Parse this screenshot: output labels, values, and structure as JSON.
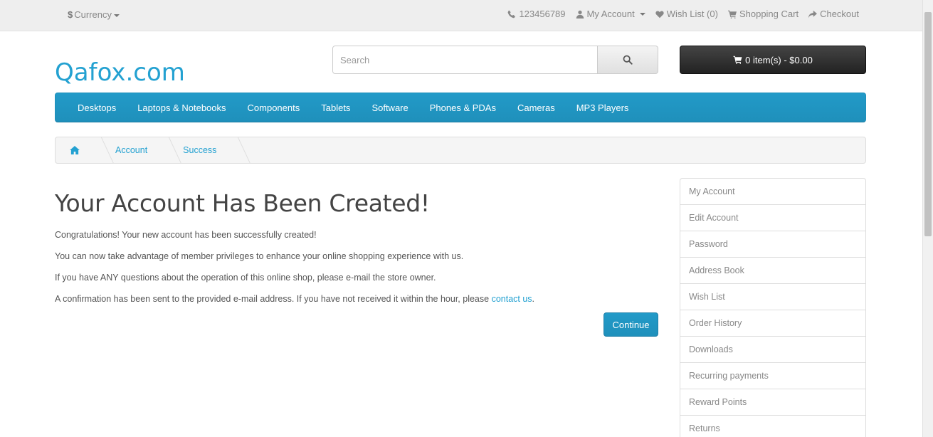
{
  "topbar": {
    "currency_symbol": "$",
    "currency_label": "Currency",
    "phone": "123456789",
    "my_account": "My Account",
    "wish_list": "Wish List (0)",
    "shopping_cart": "Shopping Cart",
    "checkout": "Checkout"
  },
  "header": {
    "logo": "Qafox.com",
    "search_placeholder": "Search",
    "cart_label": "0 item(s) - $0.00"
  },
  "menu": {
    "items": [
      "Desktops",
      "Laptops & Notebooks",
      "Components",
      "Tablets",
      "Software",
      "Phones & PDAs",
      "Cameras",
      "MP3 Players"
    ]
  },
  "breadcrumb": {
    "items": [
      "Account",
      "Success"
    ]
  },
  "main": {
    "title": "Your Account Has Been Created!",
    "p1": "Congratulations! Your new account has been successfully created!",
    "p2": "You can now take advantage of member privileges to enhance your online shopping experience with us.",
    "p3": "If you have ANY questions about the operation of this online shop, please e-mail the store owner.",
    "p4_text": "A confirmation has been sent to the provided e-mail address. If you have not received it within the hour, please ",
    "p4_link": "contact us",
    "p4_end": ".",
    "continue_label": "Continue"
  },
  "sidebar": {
    "items": [
      "My Account",
      "Edit Account",
      "Password",
      "Address Book",
      "Wish List",
      "Order History",
      "Downloads",
      "Recurring payments",
      "Reward Points",
      "Returns"
    ]
  },
  "colors": {
    "accent": "#23a1d1",
    "menu_bg": "#229ac8",
    "cart_bg": "#363636"
  }
}
